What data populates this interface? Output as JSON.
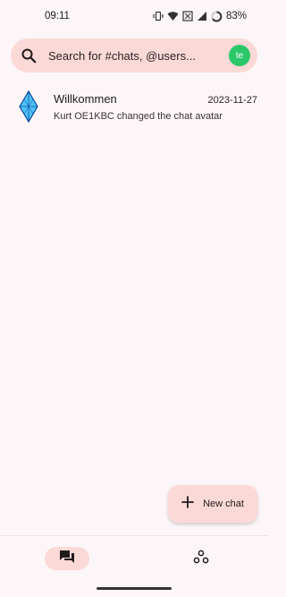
{
  "status_bar": {
    "time": "09:11",
    "battery": "83%",
    "icons": [
      "vibrate-icon",
      "wifi-icon",
      "sim-icon",
      "signal-icon",
      "battery-ring-icon"
    ]
  },
  "search": {
    "placeholder": "Search for #chats, @users...",
    "icon": "search-icon",
    "avatar_initials": "te",
    "avatar_color": "#2bc86b"
  },
  "chats": [
    {
      "name": "Willkommen",
      "date": "2023-11-27",
      "preview": "Kurt OE1KBC changed the chat avatar",
      "icon": "diamond-logo-icon"
    }
  ],
  "fab": {
    "label": "New chat",
    "icon": "plus-icon"
  },
  "bottom_nav": {
    "items": [
      {
        "icon": "chat-bubbles-icon",
        "selected": true
      },
      {
        "icon": "spaces-icon",
        "selected": false
      }
    ]
  },
  "colors": {
    "background": "#fdf6f8",
    "accent_surface": "#fbd9d6"
  }
}
